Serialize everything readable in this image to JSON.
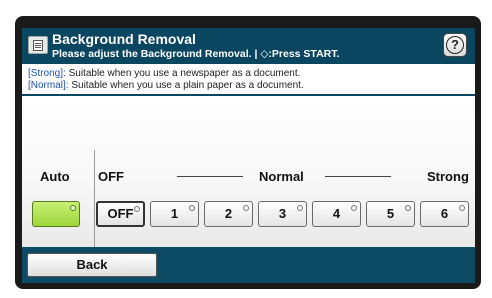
{
  "header": {
    "title": "Background Removal",
    "subtitle": "Please adjust the Background Removal. | ◇:Press START.",
    "help_label": "?"
  },
  "info": {
    "strong_tag": "[Strong]:",
    "strong_text": " Suitable when you use a newspaper as a document.",
    "normal_tag": "[Normal]:",
    "normal_text": " Suitable when you use a plain paper as a document."
  },
  "auto": {
    "label": "Auto",
    "selected": true
  },
  "scale": {
    "off_label": "OFF",
    "normal_label": "Normal",
    "strong_label": "Strong"
  },
  "levels": [
    "OFF",
    "1",
    "2",
    "3",
    "4",
    "5",
    "6"
  ],
  "selected_level": "OFF",
  "footer": {
    "back_label": "Back"
  },
  "colors": {
    "header_bg": "#0b4660",
    "auto_green": "#9ed63a"
  }
}
